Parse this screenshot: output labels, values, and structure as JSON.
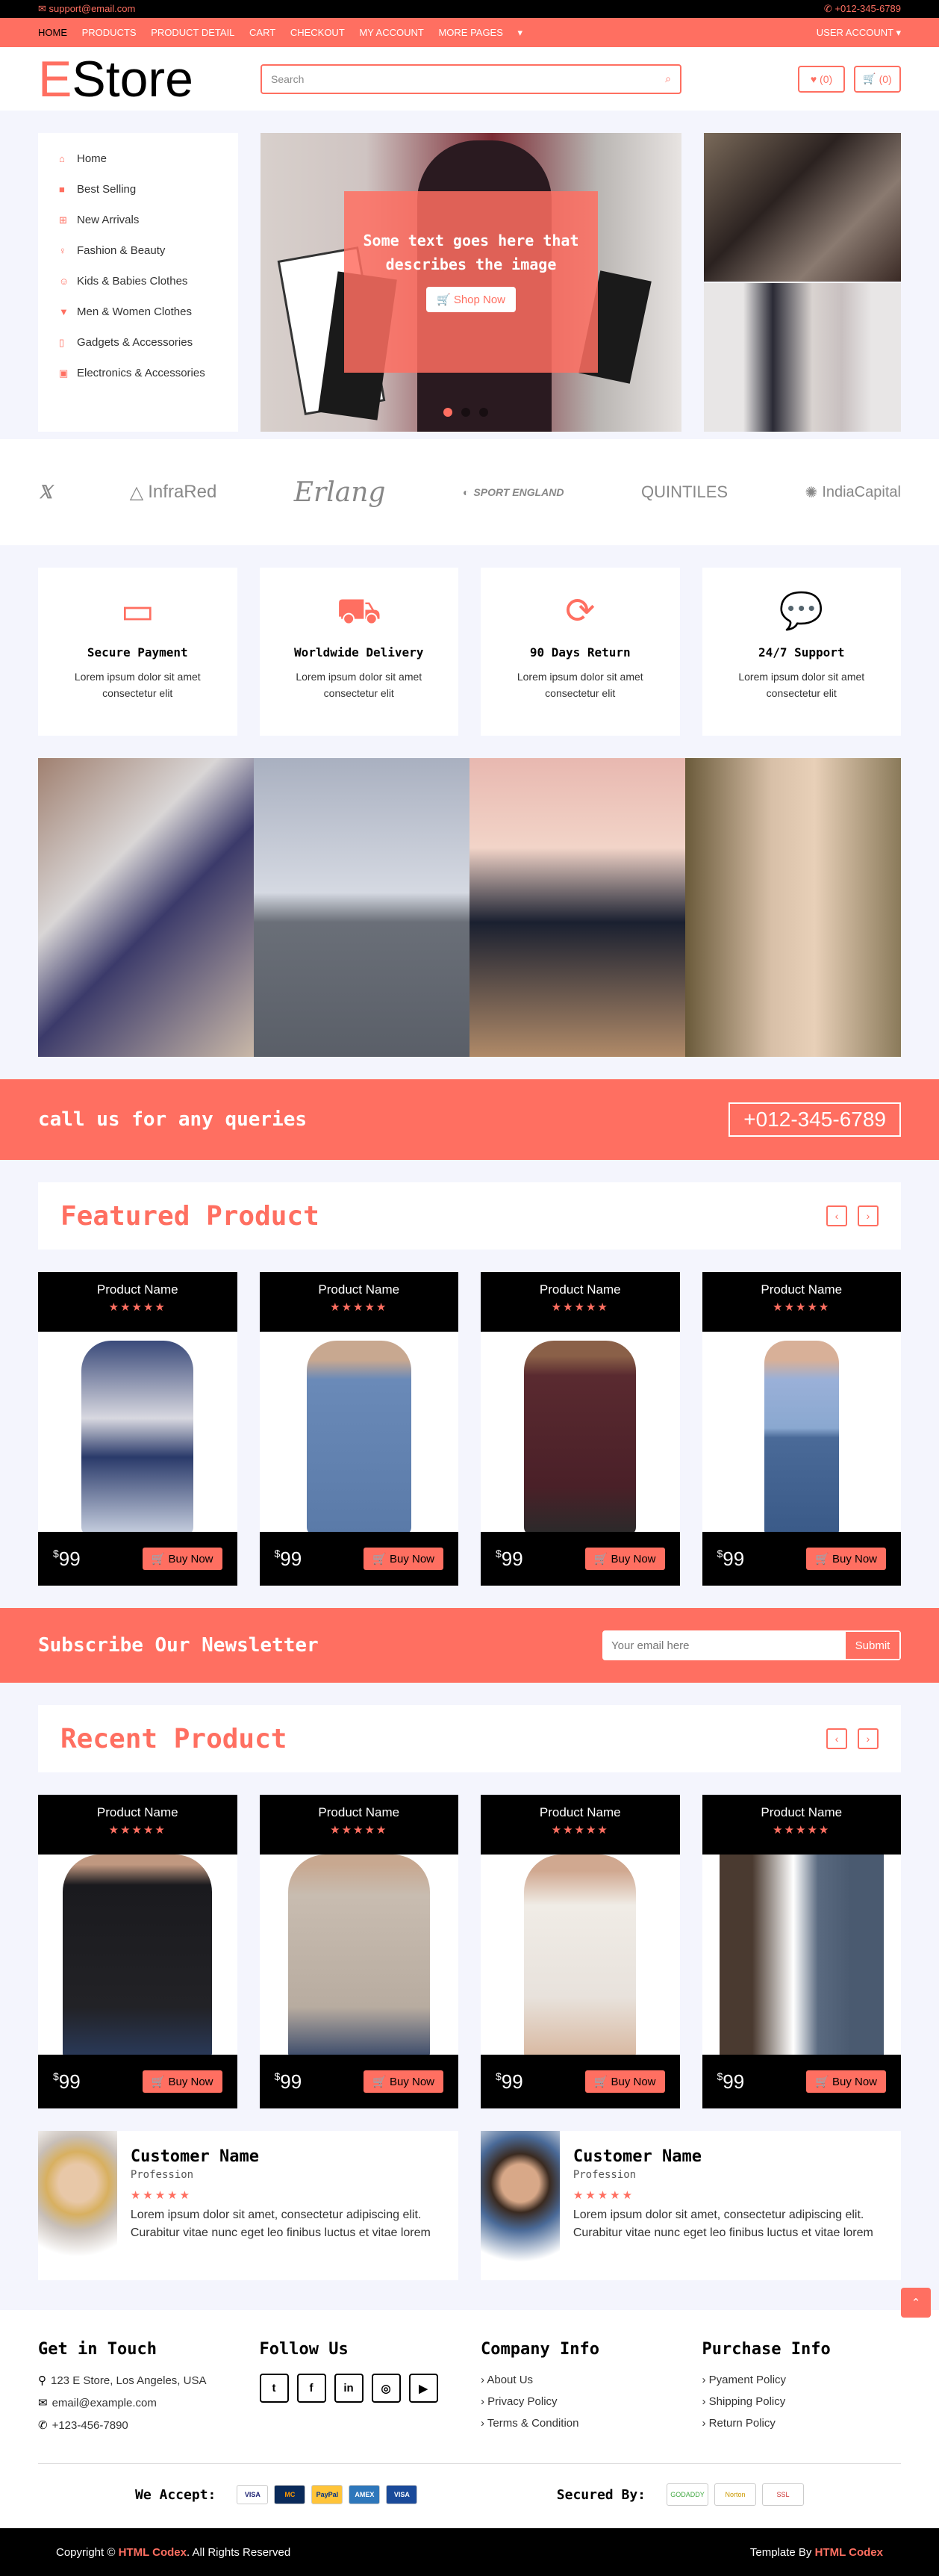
{
  "topbar": {
    "email": "support@email.com",
    "phone": "+012-345-6789"
  },
  "nav": {
    "links": [
      "HOME",
      "PRODUCTS",
      "PRODUCT DETAIL",
      "CART",
      "CHECKOUT",
      "MY ACCOUNT",
      "MORE PAGES"
    ],
    "user_account": "USER ACCOUNT"
  },
  "header": {
    "logo_initial": "E",
    "logo_rest": "Store",
    "search_placeholder": "Search",
    "wishlist_count": "(0)",
    "cart_count": "(0)"
  },
  "categories": [
    {
      "label": "Home",
      "icon": "home-icon"
    },
    {
      "label": "Best Selling",
      "icon": "shopping-bag-icon"
    },
    {
      "label": "New Arrivals",
      "icon": "plus-square-icon"
    },
    {
      "label": "Fashion & Beauty",
      "icon": "female-icon"
    },
    {
      "label": "Kids & Babies Clothes",
      "icon": "child-icon"
    },
    {
      "label": "Men & Women Clothes",
      "icon": "tshirt-icon"
    },
    {
      "label": "Gadgets & Accessories",
      "icon": "mobile-icon"
    },
    {
      "label": "Electronics & Accessories",
      "icon": "microchip-icon"
    }
  ],
  "slider": {
    "caption": "Some text goes here that describes the image",
    "button": "Shop Now"
  },
  "brands": [
    "InfraRed",
    "Erlang",
    "SPORT ENGLAND",
    "QUINTILES",
    "IndiaCapital"
  ],
  "features": [
    {
      "title": "Secure Payment",
      "text": "Lorem ipsum dolor sit amet consectetur elit",
      "icon": "credit-card-icon"
    },
    {
      "title": "Worldwide Delivery",
      "text": "Lorem ipsum dolor sit amet consectetur elit",
      "icon": "truck-icon"
    },
    {
      "title": "90 Days Return",
      "text": "Lorem ipsum dolor sit amet consectetur elit",
      "icon": "sync-icon"
    },
    {
      "title": "24/7 Support",
      "text": "Lorem ipsum dolor sit amet consectetur elit",
      "icon": "comments-icon"
    }
  ],
  "callbar": {
    "text": "call us for any queries",
    "phone": "+012-345-6789"
  },
  "featured": {
    "title": "Featured Product",
    "products": [
      {
        "name": "Product Name",
        "price": "99",
        "currency": "$",
        "buy": "Buy Now"
      },
      {
        "name": "Product Name",
        "price": "99",
        "currency": "$",
        "buy": "Buy Now"
      },
      {
        "name": "Product Name",
        "price": "99",
        "currency": "$",
        "buy": "Buy Now"
      },
      {
        "name": "Product Name",
        "price": "99",
        "currency": "$",
        "buy": "Buy Now"
      }
    ]
  },
  "newsletter": {
    "title": "Subscribe Our Newsletter",
    "placeholder": "Your email here",
    "submit": "Submit"
  },
  "recent": {
    "title": "Recent Product",
    "products": [
      {
        "name": "Product Name",
        "price": "99",
        "currency": "$",
        "buy": "Buy Now"
      },
      {
        "name": "Product Name",
        "price": "99",
        "currency": "$",
        "buy": "Buy Now"
      },
      {
        "name": "Product Name",
        "price": "99",
        "currency": "$",
        "buy": "Buy Now"
      },
      {
        "name": "Product Name",
        "price": "99",
        "currency": "$",
        "buy": "Buy Now"
      }
    ]
  },
  "reviews": [
    {
      "name": "Customer Name",
      "profession": "Profession",
      "text": "Lorem ipsum dolor sit amet, consectetur adipiscing elit. Curabitur vitae nunc eget leo finibus luctus et vitae lorem"
    },
    {
      "name": "Customer Name",
      "profession": "Profession",
      "text": "Lorem ipsum dolor sit amet, consectetur adipiscing elit. Curabitur vitae nunc eget leo finibus luctus et vitae lorem"
    }
  ],
  "footer": {
    "get_in_touch": {
      "title": "Get in Touch",
      "address": "123 E Store, Los Angeles, USA",
      "email": "email@example.com",
      "phone": "+123-456-7890"
    },
    "follow": {
      "title": "Follow Us",
      "icons": [
        "twitter-icon",
        "facebook-icon",
        "linkedin-icon",
        "instagram-icon",
        "youtube-icon"
      ]
    },
    "company": {
      "title": "Company Info",
      "links": [
        "About Us",
        "Privacy Policy",
        "Terms & Condition"
      ]
    },
    "purchase": {
      "title": "Purchase Info",
      "links": [
        "Pyament Policy",
        "Shipping Policy",
        "Return Policy"
      ]
    },
    "we_accept": "We Accept:",
    "cards": [
      "VISA",
      "MC",
      "PayPal",
      "AMEX",
      "VISA"
    ],
    "secured_by": "Secured By:",
    "seals": [
      "GODADDY",
      "Norton",
      "SSL"
    ]
  },
  "copyright": {
    "prefix": "Copyright ©",
    "brand": "HTML Codex",
    "suffix": ". All Rights Reserved",
    "template_by": "Template By",
    "template_brand": "HTML Codex"
  },
  "colors": {
    "accent": "#ff6f61",
    "dark": "#000000",
    "bg": "#f4f5fd"
  }
}
